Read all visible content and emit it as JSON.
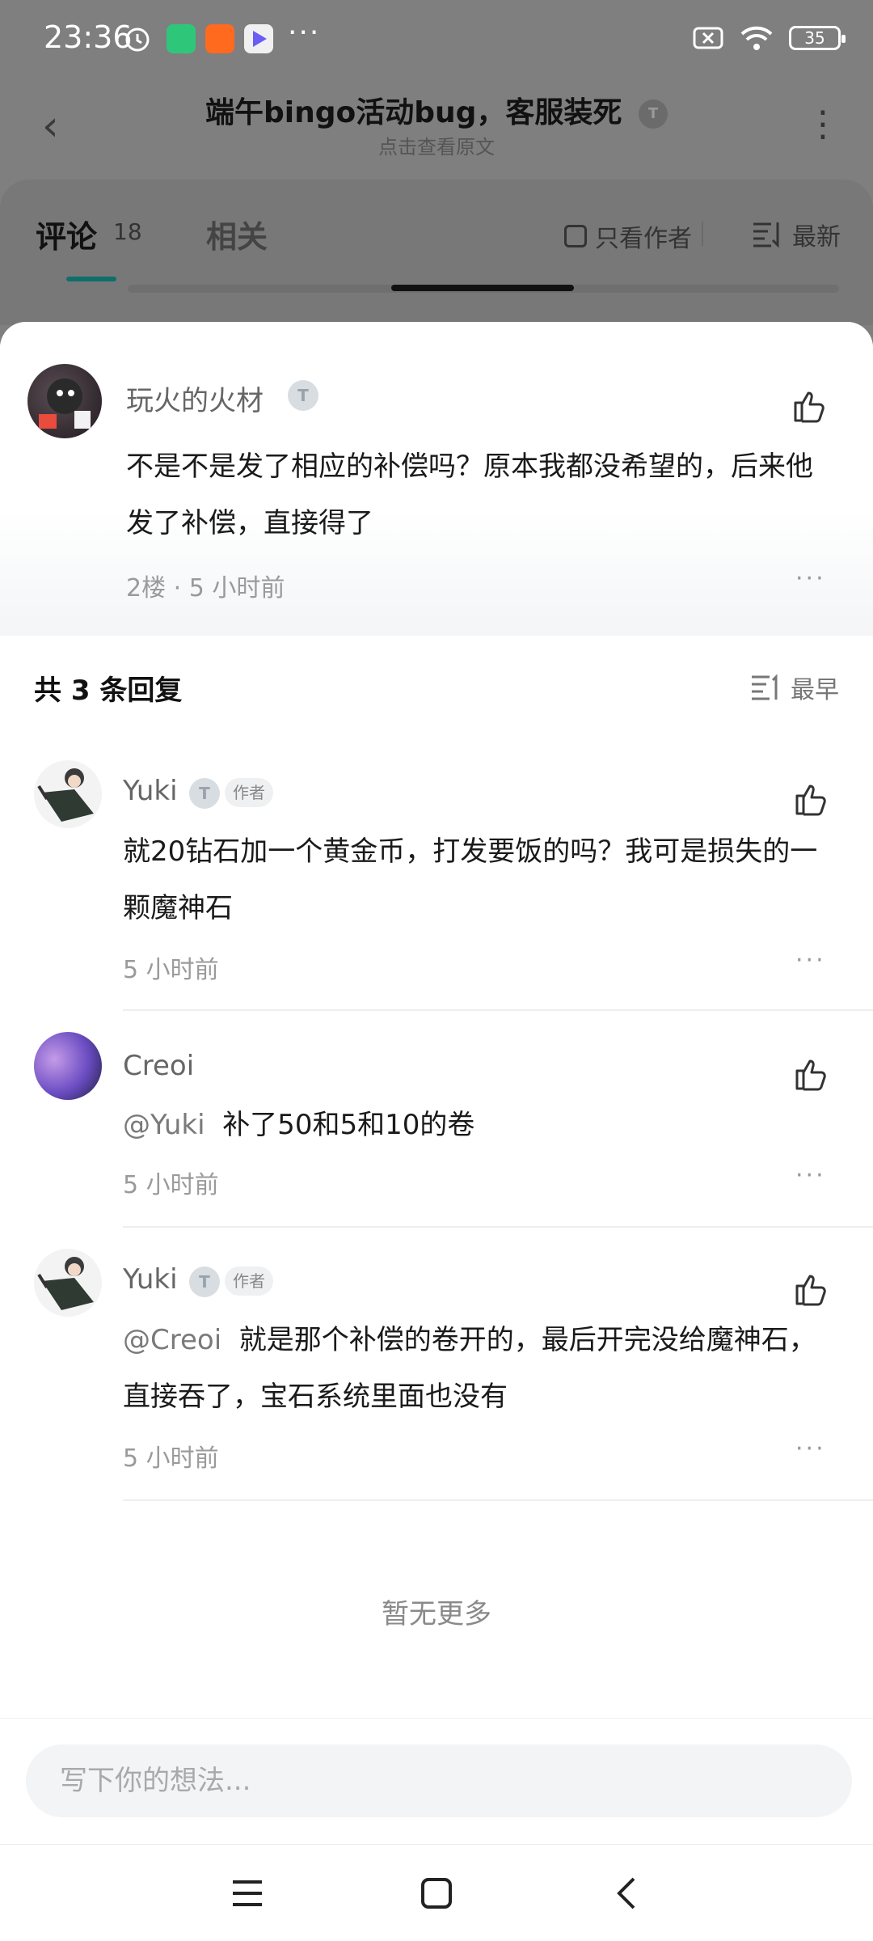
{
  "status_bar": {
    "time": "23:36",
    "more_dots": "···",
    "battery": "35",
    "icons": [
      "alarm-icon",
      "shield-app-icon",
      "taobao-app-icon",
      "play-app-icon",
      "sim-off-icon",
      "wifi-icon",
      "battery-icon"
    ]
  },
  "header": {
    "title": "端午bingo活动bug，客服装死",
    "subtitle": "点击查看原文",
    "level_badge": "T"
  },
  "tabs": {
    "comment_label": "评论",
    "comment_count": "18",
    "related_label": "相关",
    "only_author_label": "只看作者",
    "sort_label": "最新"
  },
  "main_comment": {
    "user": "玩火的火材",
    "level": "T",
    "content": "不是不是发了相应的补偿吗？原本我都没希望的，后来他发了补偿，直接得了",
    "meta": "2楼 · 5 小时前",
    "more": "···"
  },
  "replies": {
    "count_label": "共 3 条回复",
    "sort_label": "最早",
    "items": [
      {
        "user": "Yuki",
        "level": "T",
        "author_badge": "作者",
        "mention": "",
        "content": "就20钻石加一个黄金币，打发要饭的吗？我可是损失的一颗魔神石",
        "time": "5 小时前",
        "more": "···"
      },
      {
        "user": "Creoi",
        "level": "",
        "author_badge": "",
        "mention": "@Yuki",
        "content": "补了50和5和10的卷",
        "time": "5 小时前",
        "more": "···"
      },
      {
        "user": "Yuki",
        "level": "T",
        "author_badge": "作者",
        "mention": "@Creoi",
        "content": "就是那个补偿的卷开的，最后开完没给魔神石，直接吞了，宝石系统里面也没有",
        "time": "5 小时前",
        "more": "···"
      }
    ],
    "no_more": "暂无更多"
  },
  "input": {
    "placeholder": "写下你的想法..."
  },
  "nav": {
    "icons": [
      "menu-icon",
      "home-icon",
      "back-icon"
    ]
  },
  "colors": {
    "accent": "#0e6f6b",
    "dim_overlay": "#7f7f7f",
    "meta_text": "#9a9a9a"
  }
}
